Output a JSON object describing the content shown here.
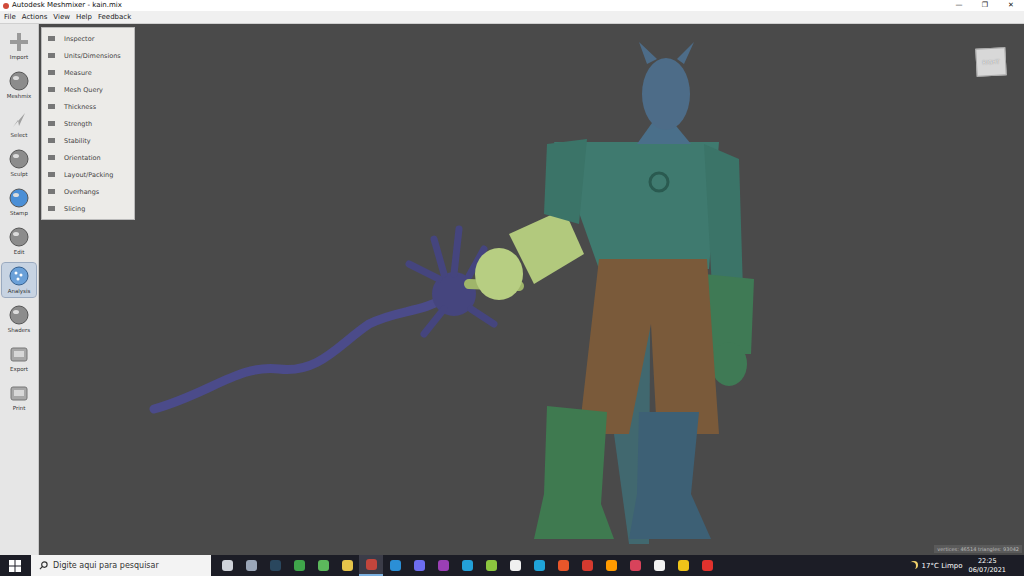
{
  "window": {
    "title": "Autodesk Meshmixer - kain.mix",
    "controls": [
      "—",
      "❐",
      "✕"
    ]
  },
  "menu_bar": [
    "File",
    "Actions",
    "View",
    "Help",
    "Feedback"
  ],
  "toolbar": [
    {
      "label": "Import",
      "selected": false
    },
    {
      "label": "Meshmix",
      "selected": false
    },
    {
      "label": "Select",
      "selected": false
    },
    {
      "label": "Sculpt",
      "selected": false
    },
    {
      "label": "Stamp",
      "selected": false
    },
    {
      "label": "Edit",
      "selected": false
    },
    {
      "label": "Analysis",
      "selected": true
    },
    {
      "label": "Shaders",
      "selected": false
    },
    {
      "label": "Export",
      "selected": false
    },
    {
      "label": "Print",
      "selected": false
    }
  ],
  "analysis_menu": [
    "Inspector",
    "Units/Dimensions",
    "Measure",
    "Mesh Query",
    "Thickness",
    "Strength",
    "Stability",
    "Orientation",
    "Layout/Packing",
    "Overhangs",
    "Slicing"
  ],
  "view_cube": "RIGHT",
  "status": "vertices: 46514 triangles: 93042",
  "taskbar": {
    "search_placeholder": "Digite aqui para pesquisar",
    "apps": [
      {
        "color": "#cfd3da",
        "selected": false
      },
      {
        "color": "#9aa6b8",
        "selected": false
      },
      {
        "color": "#2a475e",
        "selected": false
      },
      {
        "color": "#3fa54a",
        "selected": false
      },
      {
        "color": "#5cb85c",
        "selected": false
      },
      {
        "color": "#e6c44a",
        "selected": false
      },
      {
        "color": "#c2453c",
        "selected": true
      },
      {
        "color": "#2b8fd6",
        "selected": false
      },
      {
        "color": "#6d6df0",
        "selected": false
      },
      {
        "color": "#9b3fb5",
        "selected": false
      },
      {
        "color": "#23a0d8",
        "selected": false
      },
      {
        "color": "#8cc63f",
        "selected": false
      },
      {
        "color": "#f0f0f0",
        "selected": false
      },
      {
        "color": "#1fa3d8",
        "selected": false
      },
      {
        "color": "#e8562a",
        "selected": false
      },
      {
        "color": "#d43a2f",
        "selected": false
      },
      {
        "color": "#ff9a00",
        "selected": false
      },
      {
        "color": "#d8435b",
        "selected": false
      },
      {
        "color": "#f2f2f2",
        "selected": false
      },
      {
        "color": "#f0c419",
        "selected": false
      },
      {
        "color": "#e0322d",
        "selected": false
      }
    ],
    "weather": "17°C Limpo",
    "time": "22:25",
    "date": "06/07/2021"
  }
}
